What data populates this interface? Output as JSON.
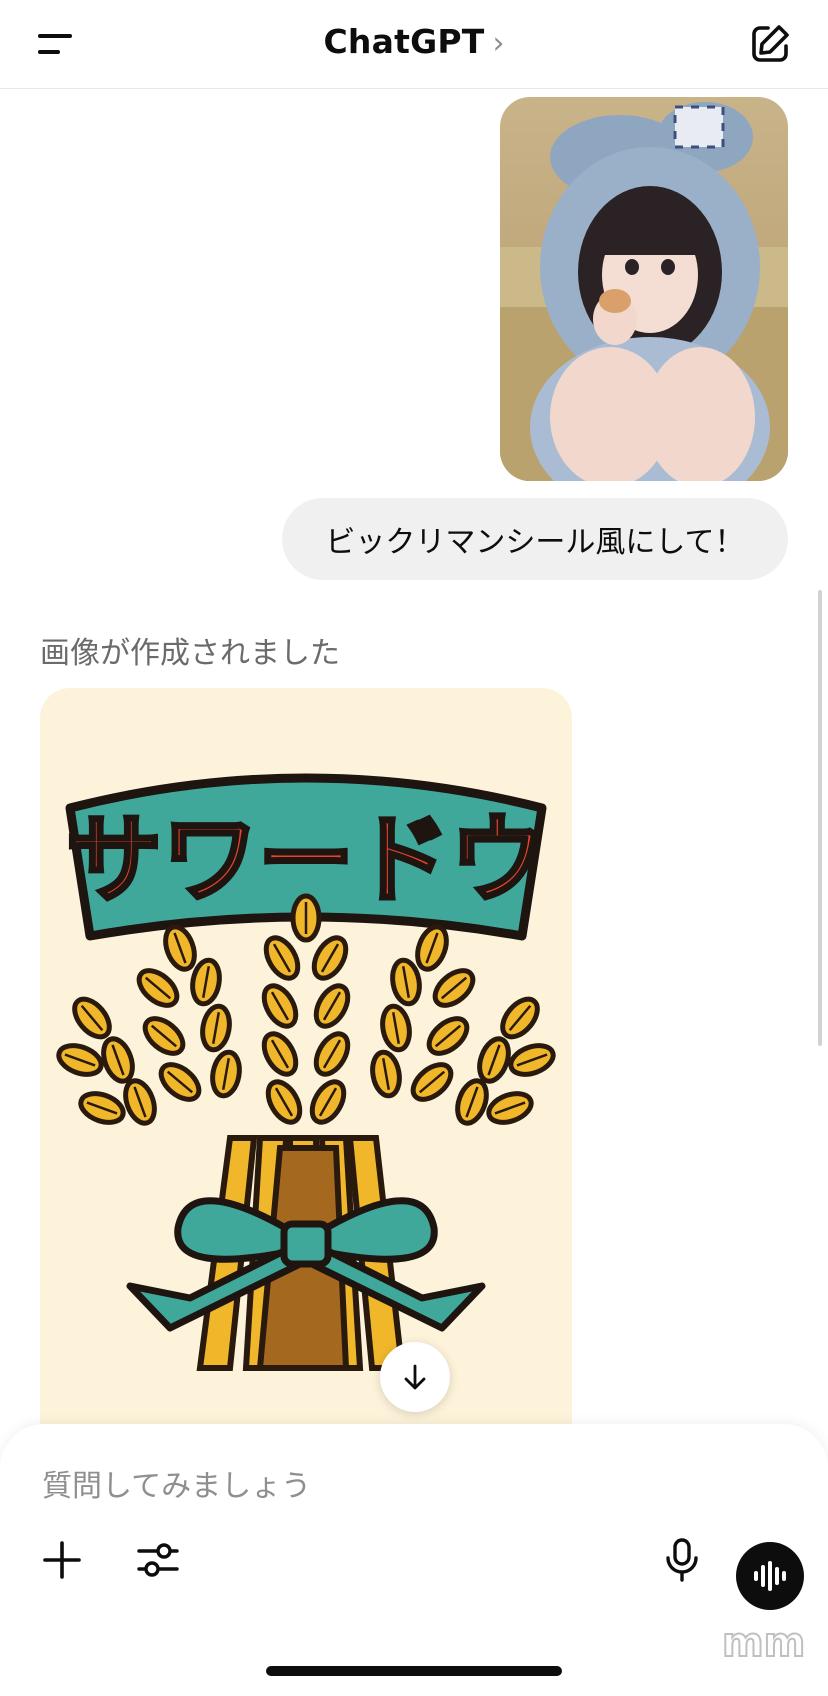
{
  "header": {
    "title": "ChatGPT",
    "title_chevron": "›"
  },
  "conversation": {
    "user_message": "ビックリマンシール風にして！",
    "assistant_status": "画像が作成されました",
    "generated_image": {
      "banner_text": "サワードウ"
    }
  },
  "composer": {
    "placeholder": "質問してみましょう"
  },
  "watermark": "mm",
  "icons": {
    "menu": "menu-icon",
    "compose": "compose-icon",
    "scroll_down": "arrow-down-icon",
    "plus": "plus-icon",
    "tools": "sliders-icon",
    "mic": "microphone-icon",
    "voice": "voice-waveform-icon"
  },
  "colors": {
    "bubble_bg": "#f0f0f0",
    "status_text": "#6b6b6b",
    "banner_teal": "#3fa89b",
    "banner_text_red": "#e8442a",
    "wheat_yellow": "#f1b72b",
    "card_bg": "#fdf3da"
  }
}
